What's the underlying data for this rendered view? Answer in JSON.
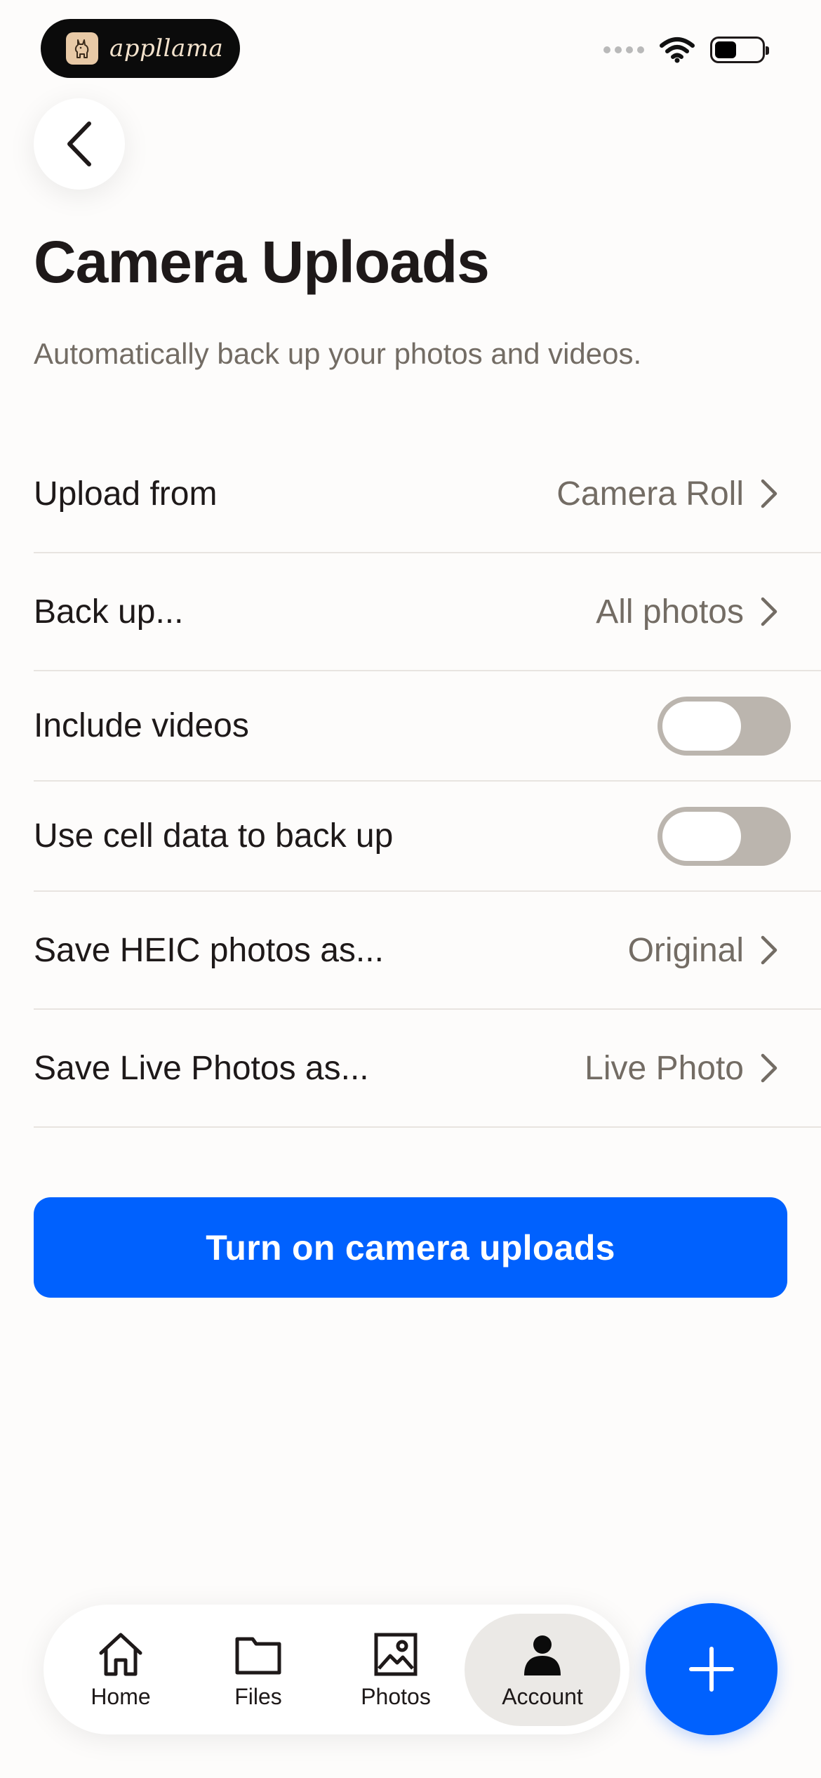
{
  "status_bar": {
    "brand_name": "appllama"
  },
  "header": {
    "back_label": "Back",
    "title": "Camera Uploads",
    "subtitle": "Automatically back up your photos and videos."
  },
  "settings": {
    "upload_from": {
      "label": "Upload from",
      "value": "Camera Roll"
    },
    "back_up": {
      "label": "Back up...",
      "value": "All photos"
    },
    "include_videos": {
      "label": "Include videos",
      "enabled": false
    },
    "cell_data": {
      "label": "Use cell data to back up",
      "enabled": false
    },
    "heic": {
      "label": "Save HEIC photos as...",
      "value": "Original"
    },
    "live_photos": {
      "label": "Save Live Photos as...",
      "value": "Live Photo"
    }
  },
  "cta": {
    "label": "Turn on camera uploads"
  },
  "nav": {
    "items": [
      {
        "label": "Home",
        "icon": "home-icon"
      },
      {
        "label": "Files",
        "icon": "folder-icon"
      },
      {
        "label": "Photos",
        "icon": "photo-icon"
      },
      {
        "label": "Account",
        "icon": "person-icon",
        "active": true
      }
    ]
  },
  "fab": {
    "icon": "plus-icon"
  },
  "colors": {
    "accent": "#0061fe",
    "text": "#1e1919",
    "muted": "#736c64",
    "toggle_off": "#bbb5ae"
  }
}
